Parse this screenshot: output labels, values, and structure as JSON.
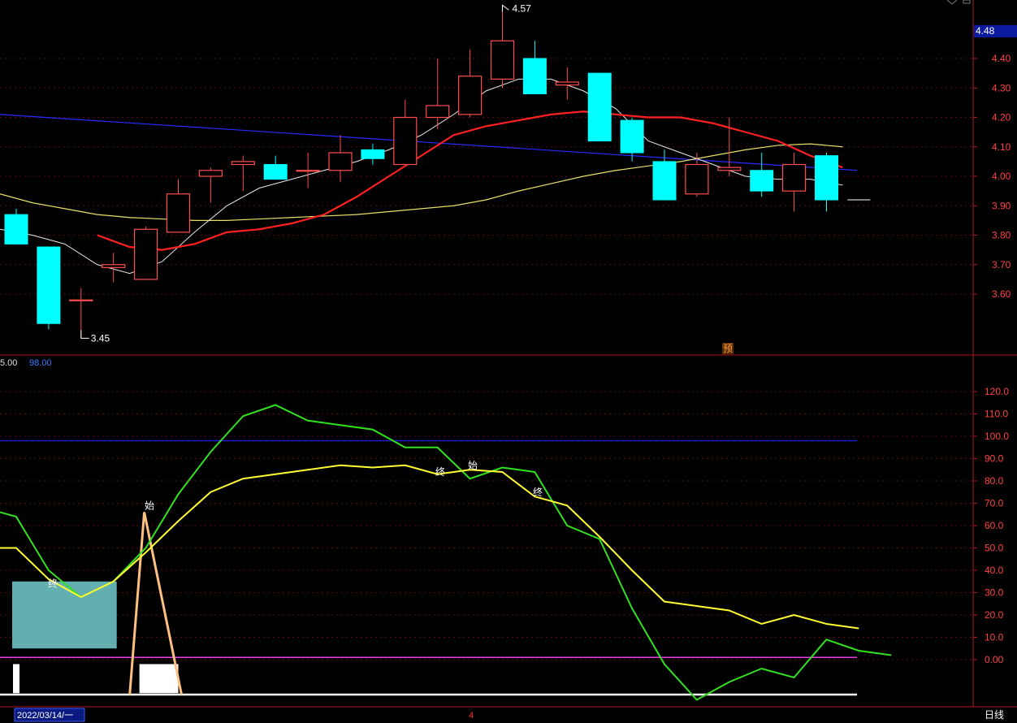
{
  "chart_data": [
    {
      "type": "candlestick",
      "panel": "price",
      "current_price_badge": "4.48",
      "max_marker": "4.57",
      "min_marker": "3.45",
      "forecast_mark": "预",
      "ylim": [
        3.47,
        4.63
      ],
      "y_ticks": [
        "4.40",
        "4.30",
        "4.20",
        "4.10",
        "4.00",
        "3.90",
        "3.80",
        "3.70",
        "3.60"
      ],
      "y_tick_values": [
        4.4,
        4.3,
        4.2,
        4.1,
        4.0,
        3.9,
        3.8,
        3.7,
        3.6
      ],
      "candles": [
        {
          "o": 3.87,
          "h": 3.89,
          "l": 3.77,
          "c": 3.77
        },
        {
          "o": 3.76,
          "h": 3.76,
          "l": 3.48,
          "c": 3.5
        },
        {
          "o": 3.58,
          "h": 3.62,
          "l": 3.45,
          "c": 3.58
        },
        {
          "o": 3.69,
          "h": 3.74,
          "l": 3.64,
          "c": 3.7
        },
        {
          "o": 3.65,
          "h": 3.83,
          "l": 3.65,
          "c": 3.82
        },
        {
          "o": 3.81,
          "h": 3.99,
          "l": 3.81,
          "c": 3.94
        },
        {
          "o": 4.0,
          "h": 4.03,
          "l": 3.91,
          "c": 4.02
        },
        {
          "o": 4.04,
          "h": 4.07,
          "l": 3.95,
          "c": 4.05
        },
        {
          "o": 4.04,
          "h": 4.07,
          "l": 3.99,
          "c": 3.99
        },
        {
          "o": 4.02,
          "h": 4.08,
          "l": 3.96,
          "c": 4.02
        },
        {
          "o": 4.02,
          "h": 4.14,
          "l": 3.98,
          "c": 4.08
        },
        {
          "o": 4.09,
          "h": 4.11,
          "l": 4.04,
          "c": 4.06
        },
        {
          "o": 4.04,
          "h": 4.26,
          "l": 4.04,
          "c": 4.2
        },
        {
          "o": 4.2,
          "h": 4.4,
          "l": 4.16,
          "c": 4.24
        },
        {
          "o": 4.21,
          "h": 4.43,
          "l": 4.2,
          "c": 4.34
        },
        {
          "o": 4.33,
          "h": 4.57,
          "l": 4.3,
          "c": 4.46
        },
        {
          "o": 4.4,
          "h": 4.46,
          "l": 4.28,
          "c": 4.28
        },
        {
          "o": 4.31,
          "h": 4.37,
          "l": 4.26,
          "c": 4.32
        },
        {
          "o": 4.35,
          "h": 4.35,
          "l": 4.12,
          "c": 4.12
        },
        {
          "o": 4.19,
          "h": 4.2,
          "l": 4.05,
          "c": 4.08
        },
        {
          "o": 4.05,
          "h": 4.09,
          "l": 3.92,
          "c": 3.92
        },
        {
          "o": 3.94,
          "h": 4.08,
          "l": 3.93,
          "c": 4.04
        },
        {
          "o": 4.02,
          "h": 4.2,
          "l": 4.0,
          "c": 4.03
        },
        {
          "o": 4.02,
          "h": 4.08,
          "l": 3.93,
          "c": 3.95
        },
        {
          "o": 3.95,
          "h": 4.08,
          "l": 3.88,
          "c": 4.04
        },
        {
          "o": 4.07,
          "h": 4.08,
          "l": 3.88,
          "c": 3.92
        },
        {
          "o": 3.92,
          "h": 3.92,
          "l": 3.92,
          "c": 3.92
        }
      ],
      "ma_white": [
        3.82,
        3.8,
        3.77,
        3.7,
        3.67,
        3.71,
        3.81,
        3.9,
        3.96,
        3.99,
        4.02,
        4.05,
        4.09,
        4.14,
        4.21,
        4.29,
        4.33,
        4.33,
        4.29,
        4.23,
        4.12,
        4.08,
        4.04,
        4.0,
        3.99,
        3.99,
        3.97
      ],
      "ma_red": [
        null,
        null,
        null,
        3.8,
        3.76,
        3.75,
        3.77,
        3.81,
        3.82,
        3.84,
        3.87,
        3.93,
        4.0,
        4.07,
        4.14,
        4.17,
        4.19,
        4.21,
        4.22,
        4.21,
        4.2,
        4.2,
        4.18,
        4.15,
        4.12,
        4.07,
        4.03
      ],
      "ma_yellow": [
        3.94,
        3.91,
        3.89,
        3.87,
        3.86,
        3.855,
        3.85,
        3.85,
        3.855,
        3.86,
        3.865,
        3.87,
        3.88,
        3.89,
        3.9,
        3.92,
        3.95,
        3.975,
        4.0,
        4.02,
        4.035,
        4.05,
        4.07,
        4.09,
        4.105,
        4.11,
        4.1
      ],
      "ma_blue": {
        "start": 4.21,
        "end": 4.02
      }
    },
    {
      "type": "line",
      "panel": "indicator",
      "header_values": [
        "5.00",
        "98.00"
      ],
      "ylim": [
        -20,
        130
      ],
      "y_ticks": [
        "120.0",
        "110.0",
        "100.0",
        "90.0",
        "80.0",
        "70.0",
        "60.0",
        "50.0",
        "40.0",
        "30.0",
        "20.0",
        "10.0",
        "0.00"
      ],
      "y_tick_values": [
        120,
        110,
        100,
        90,
        80,
        70,
        60,
        50,
        40,
        30,
        20,
        10,
        0
      ],
      "series": [
        {
          "values": [
            68,
            64,
            40,
            28,
            35,
            50,
            74,
            93,
            109,
            114,
            107,
            105,
            103,
            95,
            95,
            81,
            86,
            84,
            60,
            54,
            23,
            -2,
            -18,
            -10,
            -4,
            -8,
            9,
            4,
            2
          ]
        },
        {
          "values": [
            50,
            50,
            36,
            28,
            35,
            48,
            62,
            75,
            81,
            83,
            85,
            87,
            86,
            87,
            83,
            85,
            84,
            73,
            69,
            55,
            40,
            26,
            24,
            22,
            16,
            20,
            16,
            14
          ]
        }
      ],
      "ref_lines": [
        {
          "value": 98,
          "color": "#1d1dcc"
        },
        {
          "value": 1,
          "color": "#e83ce8"
        }
      ],
      "marks": [
        {
          "text": "终",
          "at_index": 2,
          "value": 34
        },
        {
          "text": "始",
          "at_index": 4,
          "value": 69
        },
        {
          "text": "终",
          "at_index": 13,
          "value": 84
        },
        {
          "text": "始",
          "at_index": 14,
          "value": 87
        },
        {
          "text": "终",
          "at_index": 16,
          "value": 75
        }
      ],
      "pulse": {
        "start_index": 3,
        "peak_index": 4,
        "end_index": 5,
        "peak_value": 66
      },
      "bars": [
        {
          "from_index": 0.0,
          "to_index": 3.0,
          "low": 5,
          "high": 35,
          "color": "#63aeae"
        },
        {
          "from_index": 3.8,
          "to_index": 5.0,
          "low": -15,
          "high": -2,
          "color": "#ffffff"
        },
        {
          "from_index": -0.1,
          "to_index": 0.1,
          "low": -15,
          "high": -2,
          "color": "#ffffff"
        }
      ]
    }
  ],
  "footer": {
    "date": "2022/03/14/一",
    "month_mark": "4",
    "period_label": "日线"
  },
  "colors": {
    "up": "#ff4d4d",
    "down": "#00ffff",
    "axis": "#b0171f",
    "grid": "#5a0a10",
    "tick_text": "#ff4040",
    "white_ma": "#e8e8e8",
    "red_ma": "#ff2020",
    "yellow_ma": "#e6e06a",
    "blue_ma": "#2a2aff",
    "green": "#31e31f",
    "yellow": "#ffff33",
    "pulse": "#ffc080"
  }
}
